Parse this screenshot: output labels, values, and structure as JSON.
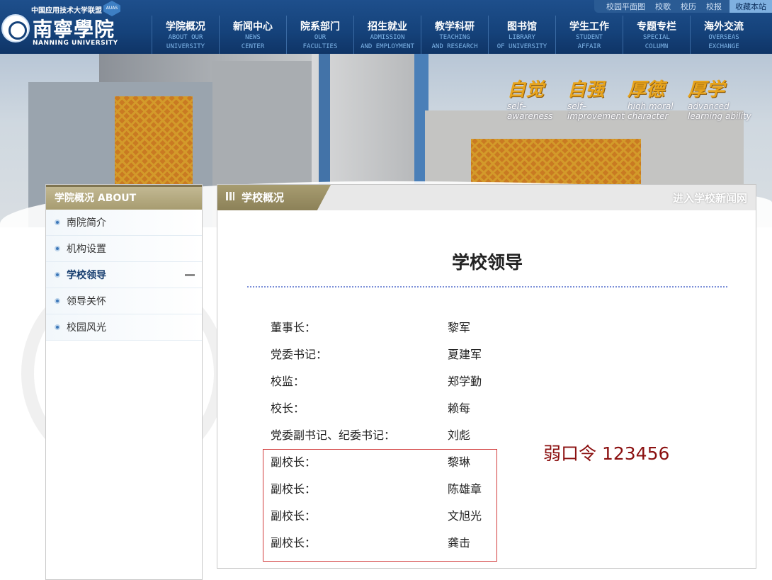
{
  "colors": {
    "nav_bg": "#15427a",
    "sidebar_head": "#a79c70",
    "accent_red": "#d23c3c",
    "weak_pwd": "#8b1010"
  },
  "header": {
    "alliance_text": "中国应用技术大学联盟",
    "badge_text": "AUAS",
    "school_name": "南寧學院",
    "school_en": "NANNING UNIVERSITY",
    "top_links": [
      "校园平面图",
      "校歌",
      "校历",
      "校报",
      "收藏本站"
    ],
    "nav": [
      {
        "zh": "学院概况",
        "en": "ABOUT OUR\nUNIVERSITY"
      },
      {
        "zh": "新闻中心",
        "en": "NEWS\nCENTER"
      },
      {
        "zh": "院系部门",
        "en": "OUR\nFACULTIES"
      },
      {
        "zh": "招生就业",
        "en": "ADMISSION\nAND EMPLOYMENT"
      },
      {
        "zh": "教学科研",
        "en": "TEACHING\nAND RESEARCH"
      },
      {
        "zh": "图书馆",
        "en": "LIBRARY\nOF UNIVERSITY"
      },
      {
        "zh": "学生工作",
        "en": "STUDENT\nAFFAIR"
      },
      {
        "zh": "专题专栏",
        "en": "SPECIAL\nCOLUMN"
      },
      {
        "zh": "海外交流",
        "en": "OVERSEAS\nEXCHANGE"
      }
    ]
  },
  "banner": {
    "mottos": [
      {
        "zh": "自觉",
        "en": "self–\nawareness"
      },
      {
        "zh": "自强",
        "en": "self–\nimprovement"
      },
      {
        "zh": "厚德",
        "en": "high moral\ncharacter"
      },
      {
        "zh": "厚学",
        "en": "advanced\nlearning ability"
      }
    ]
  },
  "sidebar": {
    "title": "学院概况 ABOUT",
    "items": [
      {
        "label": "南院简介",
        "active": false
      },
      {
        "label": "机构设置",
        "active": false
      },
      {
        "label": "学校领导",
        "active": true
      },
      {
        "label": "领导关怀",
        "active": false
      },
      {
        "label": "校园风光",
        "active": false
      }
    ]
  },
  "content": {
    "tab_title": "学校概况",
    "news_link": "进入学校新闻网",
    "page_title": "学校领导",
    "leaders": [
      {
        "role": "董事长：",
        "name": "黎军"
      },
      {
        "role": "党委书记：",
        "name": "夏建军"
      },
      {
        "role": "校监：",
        "name": "郑学勤"
      },
      {
        "role": "校长：",
        "name": "赖每"
      },
      {
        "role": "党委副书记、纪委书记：",
        "name": "刘彪"
      },
      {
        "role": "副校长：",
        "name": "黎琳"
      },
      {
        "role": "副校长：",
        "name": "陈雄章"
      },
      {
        "role": "副校长：",
        "name": "文旭光"
      },
      {
        "role": "副校长：",
        "name": "龚击"
      }
    ],
    "weak_password_label": "弱口令",
    "weak_password_value": "123456"
  }
}
